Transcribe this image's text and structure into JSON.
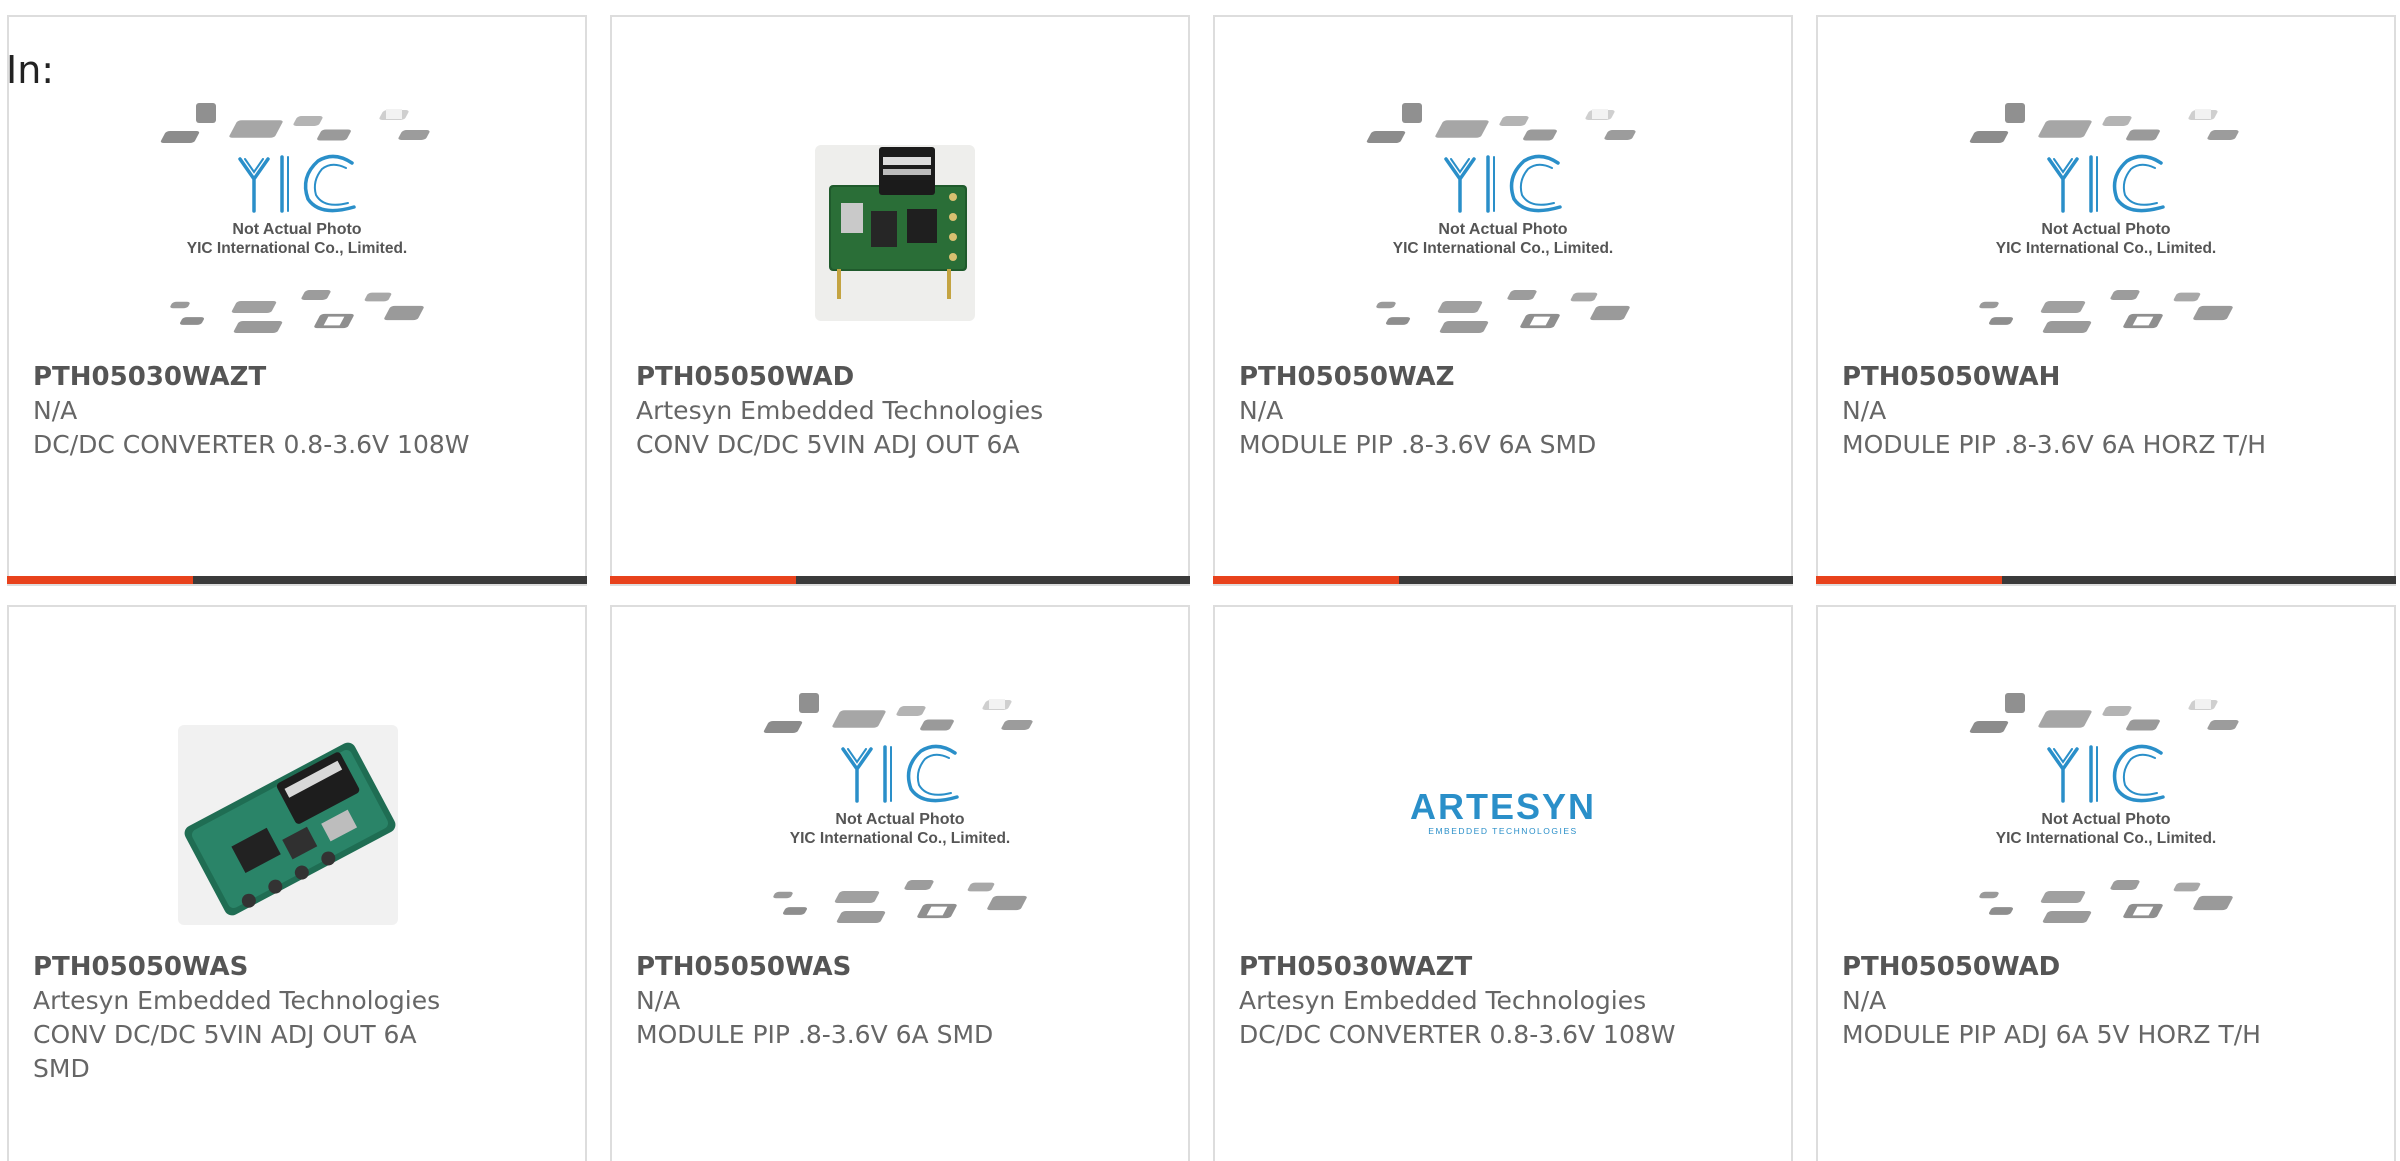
{
  "heading": "In:",
  "watermark": {
    "logo_text": "YIC",
    "line1": "Not Actual Photo",
    "line2": "YIC International Co., Limited."
  },
  "artesyn_logo": {
    "name": "ARTESYN",
    "tagline": "EMBEDDED TECHNOLOGIES"
  },
  "colors": {
    "accent": "#e8421c",
    "bar_dark": "#3a3a3a",
    "logo_blue": "#2a8fc9"
  },
  "progress_fraction": 0.32,
  "products": [
    {
      "part": "PTH05030WAZT",
      "manufacturer": "N/A",
      "description": "DC/DC CONVERTER 0.8-3.6V 108W",
      "image": "not-actual-photo"
    },
    {
      "part": "PTH05050WAD",
      "manufacturer": "Artesyn Embedded Technologies",
      "description": "CONV DC/DC 5VIN ADJ OUT 6A",
      "image": "module-vertical-photo"
    },
    {
      "part": "PTH05050WAZ",
      "manufacturer": "N/A",
      "description": "MODULE PIP .8-3.6V 6A SMD",
      "image": "not-actual-photo"
    },
    {
      "part": "PTH05050WAH",
      "manufacturer": "N/A",
      "description": "MODULE PIP .8-3.6V 6A HORZ T/H",
      "image": "not-actual-photo"
    },
    {
      "part": "PTH05050WAS",
      "manufacturer": "Artesyn Embedded Technologies",
      "description": "CONV DC/DC 5VIN ADJ OUT 6A SMD",
      "image": "module-smd-photo"
    },
    {
      "part": "PTH05050WAS",
      "manufacturer": "N/A",
      "description": "MODULE PIP .8-3.6V 6A SMD",
      "image": "not-actual-photo"
    },
    {
      "part": "PTH05030WAZT",
      "manufacturer": "Artesyn Embedded Technologies",
      "description": "DC/DC CONVERTER 0.8-3.6V 108W",
      "image": "artesyn-logo"
    },
    {
      "part": "PTH05050WAD",
      "manufacturer": "N/A",
      "description": "MODULE PIP ADJ 6A 5V HORZ T/H",
      "image": "not-actual-photo"
    }
  ]
}
